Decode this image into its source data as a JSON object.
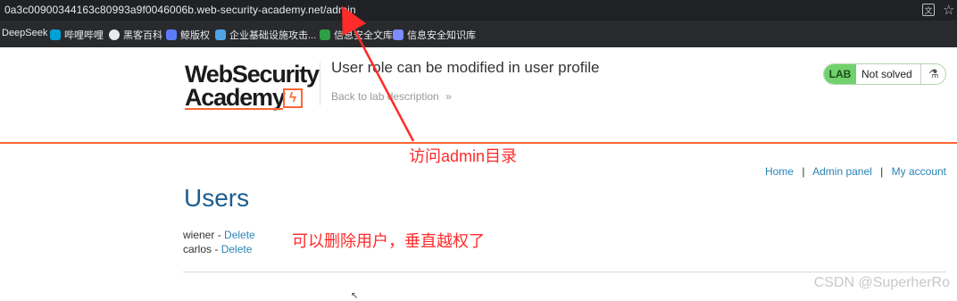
{
  "browser": {
    "url_host": "0a3c00900344163c80993a9f0046006b.web-security-academy.net",
    "url_path": "/admin",
    "translate_icon": "translate-icon",
    "star_icon": "star-icon",
    "bookmarks": [
      {
        "label": "DeepSeek",
        "icon": "deepseek-icon",
        "color": "#4d6bfe"
      },
      {
        "label": "哔哩哔哩",
        "icon": "bilibili-icon",
        "color": "#00a1d6"
      },
      {
        "label": "黑客百科",
        "icon": "github-icon",
        "color": "#e8eaed"
      },
      {
        "label": "鲸版权",
        "icon": "whale-icon",
        "color": "#5b7cfa"
      },
      {
        "label": "企业基础设施攻击...",
        "icon": "cube-icon",
        "color": "#4fa3e8"
      },
      {
        "label": "信息安全文库",
        "icon": "shield-plus-icon",
        "color": "#2ea043"
      },
      {
        "label": "信息安全知识库",
        "icon": "diamond-icon",
        "color": "#7c8cff"
      }
    ]
  },
  "header": {
    "logo_line1": "WebSecurity",
    "logo_line2": "Academy",
    "logo_bolt": "ϟ",
    "lab_title": "User role can be modified in user profile",
    "back_link": "Back to lab description",
    "back_chevron": "»",
    "status_badge": "LAB",
    "status_text": "Not solved",
    "flask_glyph": "⚗"
  },
  "nav": {
    "home": "Home",
    "admin_panel": "Admin panel",
    "my_account": "My account",
    "separator": "|"
  },
  "page": {
    "heading": "Users",
    "users": [
      {
        "name": "wiener",
        "dash": " - ",
        "action": "Delete"
      },
      {
        "name": "carlos",
        "dash": " - ",
        "action": "Delete"
      }
    ]
  },
  "annotations": {
    "note1": "访问admin目录",
    "note2": "可以删除用户，垂直越权了",
    "color": "#ff2a2a"
  },
  "watermark": "CSDN @SuperherRo",
  "colors": {
    "accent_orange": "#ff6633",
    "link_blue": "#2a83b5",
    "heading_blue": "#1d5d8f",
    "lab_green": "#70d16d"
  }
}
